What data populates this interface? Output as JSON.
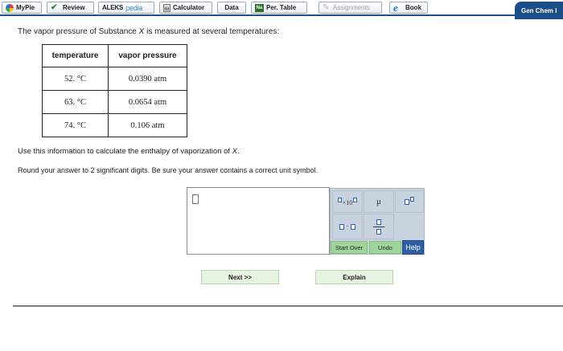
{
  "toolbar": {
    "mypie": "MyPie",
    "review": "Review",
    "aleks_main": "ALEKS",
    "aleks_suffix": "pedia",
    "calculator": "Calculator",
    "data": "Data",
    "per_table": "Per. Table",
    "ptable_icon_text": "Na",
    "assignments": "Assignments",
    "ebook_icon_text": "e",
    "book": "Book",
    "course_tab": "Gen Chem I"
  },
  "question": {
    "intro_before": "The vapor pressure of Substance ",
    "intro_var": "X",
    "intro_after": " is measured at several temperatures:",
    "table": {
      "headers": [
        "temperature",
        "vapor pressure"
      ],
      "rows": [
        [
          "52. °C",
          "0.0390 atm"
        ],
        [
          "63. °C",
          "0.0654 atm"
        ],
        [
          "74. °C",
          "0.106 atm"
        ]
      ]
    },
    "instruction_before": "Use this information to calculate the enthalpy of vaporization of ",
    "instruction_var": "X",
    "instruction_after": ".",
    "rounding": "Round your answer to 2 significant digits. Be sure your answer contains a correct unit symbol."
  },
  "answer_palette": {
    "sci_times": "×10",
    "mu": "μ",
    "dot_op": "·",
    "start_over": "Start Over",
    "undo": "Undo",
    "help": "Help"
  },
  "nav": {
    "next": "Next >>",
    "explain": "Explain"
  },
  "colors": {
    "brand_blue": "#1c4f8a",
    "palette_bg": "#c9d3df",
    "action_green": "#9fd49a",
    "nav_green": "#e6f3e1",
    "help_blue": "#2e5fa3"
  }
}
